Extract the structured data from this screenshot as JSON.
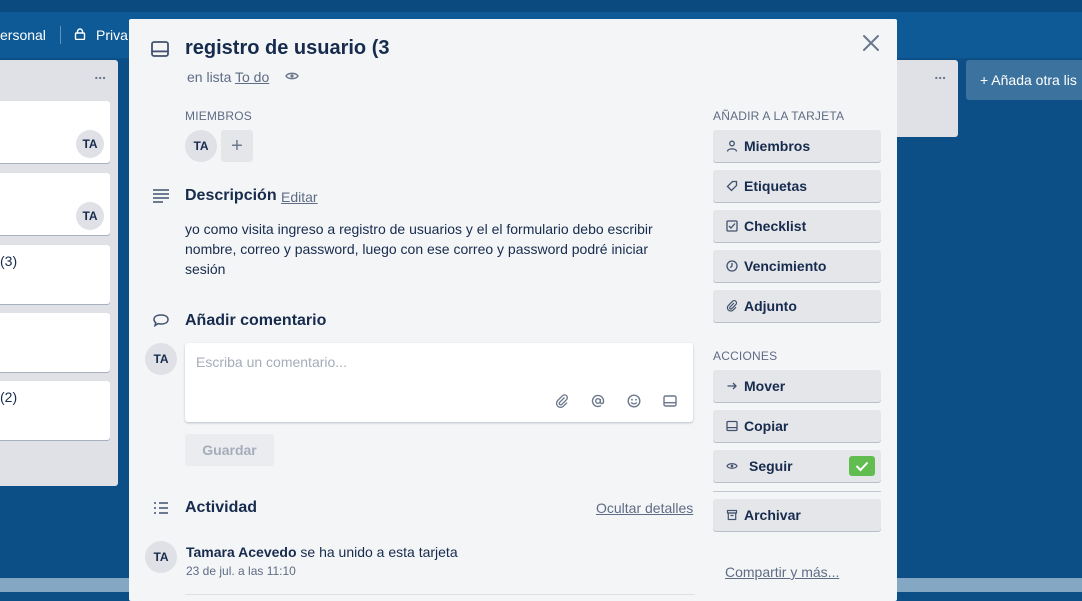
{
  "background": {
    "board_bar": {
      "visibility_prev": "ersonal",
      "visibility": "Priva"
    },
    "list_left": {
      "menu": "...",
      "cards": [
        {
          "text": "",
          "avatar": "TA"
        },
        {
          "text": "",
          "avatar": "TA"
        },
        {
          "text": "(3)",
          "avatar": ""
        },
        {
          "text": "",
          "avatar": ""
        },
        {
          "text": "(2)",
          "avatar": ""
        }
      ]
    },
    "list_right": {
      "menu": "..."
    },
    "add_list": "+ Añada otra lis"
  },
  "modal": {
    "title": "registro de usuario (3",
    "in_list_prefix": "en lista ",
    "list_name": "To do",
    "members": {
      "label": "MIEMBROS",
      "avatars": [
        "TA"
      ],
      "add": "+"
    },
    "description": {
      "title": "Descripción",
      "edit": "Editar",
      "text": "yo como visita ingreso a registro de usuarios y el el formulario debo escribir nombre, correo y password, luego con ese correo y password podré iniciar sesión"
    },
    "comment": {
      "title": "Añadir comentario",
      "avatar": "TA",
      "placeholder": "Escriba un comentario...",
      "save": "Guardar"
    },
    "activity": {
      "title": "Actividad",
      "hide_details": "Ocultar detalles",
      "entries": [
        {
          "avatar": "TA",
          "user": "Tamara Acevedo",
          "action": " se ha unido a esta tarjeta",
          "date": "23 de jul. a las 11:10"
        }
      ]
    },
    "sidebar": {
      "add_label": "AÑADIR A LA TARJETA",
      "add_buttons": [
        "Miembros",
        "Etiquetas",
        "Checklist",
        "Vencimiento",
        "Adjunto"
      ],
      "actions_label": "ACCIONES",
      "action_buttons": [
        "Mover",
        "Copiar",
        "Seguir"
      ],
      "archive": "Archivar",
      "share": "Compartir y más..."
    }
  },
  "colors": {
    "accent_green": "#61bd4f",
    "board_blue": "#0b4f86"
  }
}
